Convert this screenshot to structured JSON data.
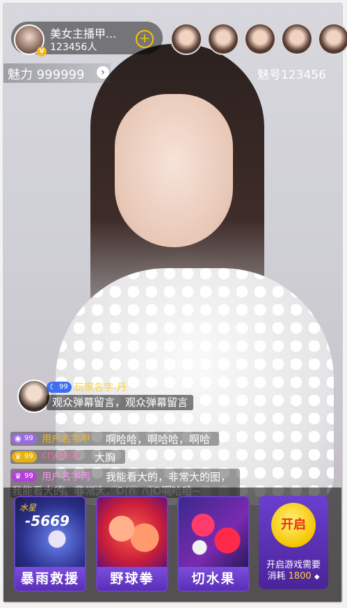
{
  "anchor": {
    "name": "美女主播甲...",
    "viewers": "123456人",
    "badge": "V",
    "follow_icon": "plus-icon"
  },
  "charm": {
    "label": "魅力 999999",
    "arrow": "›"
  },
  "room": {
    "id": "魅号123456"
  },
  "chat": [
    {
      "level": "99",
      "level_icon": "☾",
      "level_color": "#3c6ff0",
      "name": "玩家名字-丹",
      "name_color": "#ffd22e",
      "text": "观众弹幕留言，观众弹幕留言"
    },
    {
      "level": "99",
      "level_icon": "◉",
      "level_color": "#9b6ce0",
      "name": "用户名字甲",
      "name_color": "#f2b418",
      "text": "啊哈哈，啊哈哈，啊哈"
    },
    {
      "level": "99",
      "level_icon": "♛",
      "level_color": "#e8b20e",
      "name": "crystalo",
      "name_color": "#ff5fa8",
      "text": "大胸"
    },
    {
      "level": "99",
      "level_icon": "♛",
      "level_color": "#b340d8",
      "name": "用户名字丙",
      "name_color": "#ff8df0",
      "text": "我能看大的，非常大的图，",
      "text2": "我能看大的，非常大。O(∩_∩)O啊哈哈~"
    }
  ],
  "games": [
    {
      "label": "暴雨救援",
      "art_text": "水星",
      "art_number": "-5669"
    },
    {
      "label": "野球拳"
    },
    {
      "label": "切水果"
    }
  ],
  "open": {
    "button": "开启",
    "line1": "开启游戏需要",
    "line2_prefix": "消耗",
    "cost": "1800",
    "cost_icon": "◆"
  }
}
